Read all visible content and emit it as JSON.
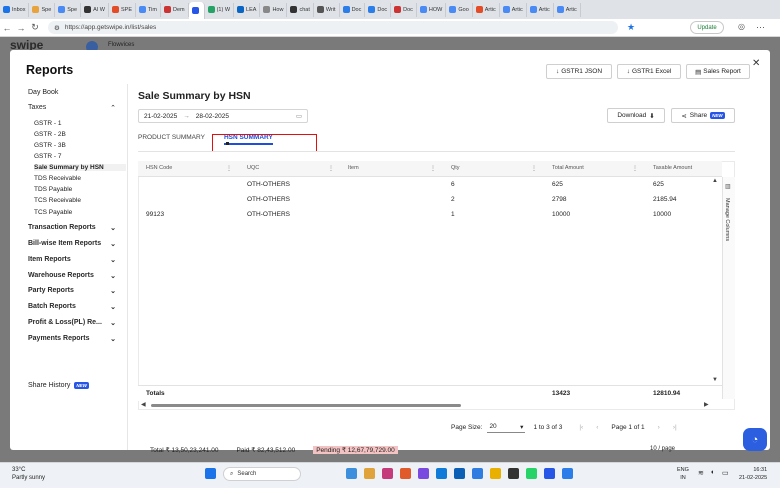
{
  "browser": {
    "tabs": [
      {
        "label": "Inbox",
        "color": "#1a73e8"
      },
      {
        "label": "Spe",
        "color": "#e8a33d"
      },
      {
        "label": "Spe",
        "color": "#4a8af4"
      },
      {
        "label": "AI W",
        "color": "#333333"
      },
      {
        "label": "SPE",
        "color": "#e34c26"
      },
      {
        "label": "Tim",
        "color": "#4a8af4"
      },
      {
        "label": "Dem",
        "color": "#cc3333"
      },
      {
        "label": "",
        "color": "#2755e6",
        "active": true
      },
      {
        "label": "(1) W",
        "color": "#25a366"
      },
      {
        "label": "LEA",
        "color": "#0a66c2"
      },
      {
        "label": "How",
        "color": "#888888"
      },
      {
        "label": "chat",
        "color": "#333333"
      },
      {
        "label": "Writ",
        "color": "#555555"
      },
      {
        "label": "Doc",
        "color": "#2b7de9"
      },
      {
        "label": "Doc",
        "color": "#2b7de9"
      },
      {
        "label": "Doc",
        "color": "#cc3333"
      },
      {
        "label": "HOW",
        "color": "#4a8af4"
      },
      {
        "label": "Goo",
        "color": "#4a8af4"
      },
      {
        "label": "Artic",
        "color": "#e34c26"
      },
      {
        "label": "Artic",
        "color": "#4a8af4"
      },
      {
        "label": "Artic",
        "color": "#4a8af4"
      },
      {
        "label": "Artic",
        "color": "#4a8af4"
      }
    ],
    "url": "https://app.getswipe.in/list/sales",
    "update_label": "Update"
  },
  "background_app": {
    "logo": "swipe",
    "company": "Flowvices",
    "footer": {
      "total": "Total ₹ 13,50,23,241.00",
      "paid": "Paid ₹ 82,43,512.00",
      "pending": "Pending ₹ 12,67,79,729.00",
      "page_info": "10 / page"
    }
  },
  "modal": {
    "title": "Reports",
    "buttons": {
      "gstr1_json": "GSTR1 JSON",
      "gstr1_excel": "GSTR1 Excel",
      "sales_report": "Sales Report"
    }
  },
  "sidebar": {
    "day_book": "Day Book",
    "taxes": "Taxes",
    "tax_items": [
      "GSTR - 1",
      "GSTR - 2B",
      "GSTR - 3B",
      "GSTR - 7",
      "Sale Summary by HSN",
      "TDS Receivable",
      "TDS Payable",
      "TCS Receivable",
      "TCS Payable"
    ],
    "groups": [
      "Transaction Reports",
      "Bill-wise Item Reports",
      "Item Reports",
      "Warehouse Reports",
      "Party Reports",
      "Batch Reports",
      "Profit & Loss(PL) Re...",
      "Payments Reports"
    ],
    "share_history": "Share History",
    "new_badge": "NEW"
  },
  "main": {
    "title": "Sale Summary by HSN",
    "date_from": "21-02-2025",
    "date_to": "28-02-2025",
    "download_label": "Download",
    "share_label": "Share",
    "share_badge": "NEW",
    "tabs": [
      "PRODUCT SUMMARY",
      "HSN SUMMARY"
    ]
  },
  "table": {
    "columns": [
      "HSN Code",
      "UQC",
      "Item",
      "Qty",
      "Total Amount",
      "Taxable Amount"
    ],
    "rows": [
      [
        "",
        "OTH-OTHERS",
        "",
        "6",
        "625",
        "625"
      ],
      [
        "",
        "OTH-OTHERS",
        "",
        "2",
        "2798",
        "2185.94"
      ],
      [
        "99123",
        "OTH-OTHERS",
        "",
        "1",
        "10000",
        "10000"
      ]
    ],
    "totals_label": "Totals",
    "totals_amount": "13423",
    "totals_taxable": "12810.94",
    "manage_columns": "Manage Columns"
  },
  "pager": {
    "page_size_label": "Page Size:",
    "page_size": "20",
    "range": "1 to 3 of 3",
    "page_info": "Page 1 of 1"
  },
  "taskbar": {
    "temp": "33°C",
    "weather": "Partly sunny",
    "search": "Search",
    "lang1": "ENG",
    "lang2": "IN",
    "time": "16:31",
    "date": "21-02-2025"
  }
}
